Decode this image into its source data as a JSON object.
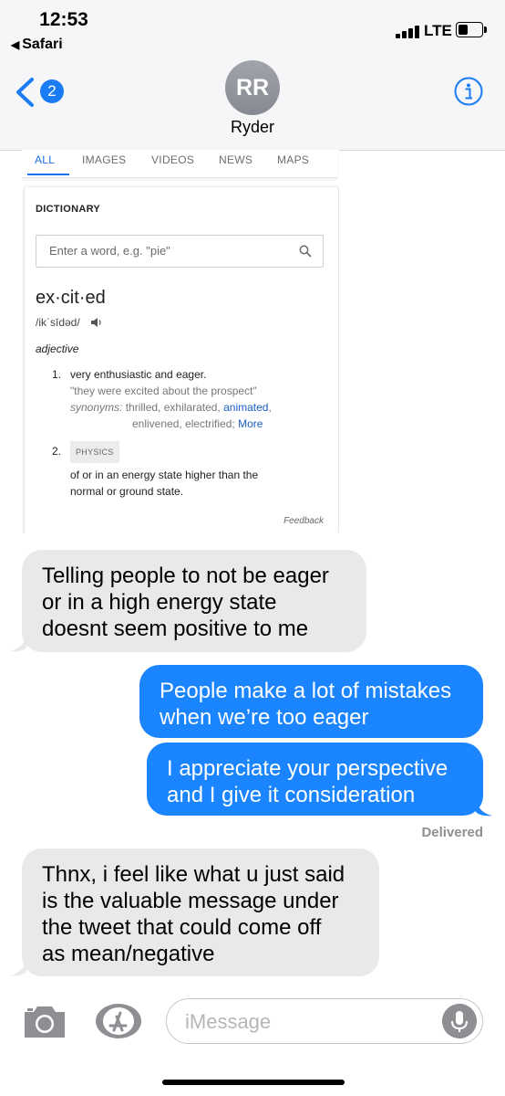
{
  "status_bar": {
    "time": "12:53",
    "back_app": "Safari",
    "network": "LTE"
  },
  "header": {
    "unread_count": "2",
    "avatar_initials": "RR",
    "contact_name": "Ryder"
  },
  "embedded_screenshot": {
    "tabs": [
      {
        "label": "ALL",
        "active": true
      },
      {
        "label": "IMAGES",
        "active": false
      },
      {
        "label": "VIDEOS",
        "active": false
      },
      {
        "label": "NEWS",
        "active": false
      },
      {
        "label": "MAPS",
        "active": false
      }
    ],
    "dictionary_label": "DICTIONARY",
    "search_placeholder": "Enter a word, e.g. \"pie\"",
    "headword": "ex·cit·ed",
    "pronunciation": "/ikˈsīdəd/",
    "part_of_speech": "adjective",
    "sense1": {
      "number": "1.",
      "definition": "very enthusiastic and eager.",
      "example": "\"they were excited about the prospect\"",
      "synonyms_label": "synonyms:",
      "synonyms_a": "thrilled, exhilarated, ",
      "synonyms_link": "animated",
      "synonyms_b": ",",
      "synonyms_c": "enlivened, electrified;",
      "more": "More"
    },
    "sense2": {
      "number": "2.",
      "tag": "PHYSICS",
      "definition_line1": "of or in an energy state higher than the",
      "definition_line2": "normal or ground state."
    },
    "feedback": "Feedback"
  },
  "messages": [
    {
      "direction": "incoming",
      "lines": [
        "Telling people to not be eager",
        "or in a high energy state",
        "doesnt seem positive to me"
      ]
    },
    {
      "direction": "outgoing",
      "lines": [
        "People make a lot of mistakes",
        "when we’re too eager"
      ]
    },
    {
      "direction": "outgoing",
      "lines": [
        "I appreciate your perspective",
        "and I give it consideration"
      ]
    },
    {
      "direction": "incoming",
      "lines": [
        "Thnx, i feel like what u just said",
        "is the valuable message under",
        "the tweet that could come off",
        "as mean/negative"
      ]
    }
  ],
  "delivery_status": "Delivered",
  "input_bar": {
    "placeholder": "iMessage"
  },
  "colors": {
    "imessage_blue": "#1b84ff",
    "incoming_gray": "#e9e9eb",
    "link_blue": "#1a73e8",
    "ios_blue": "#1a7cf5"
  },
  "icons": [
    "camera-icon",
    "app-store-icon",
    "microphone-icon",
    "info-icon",
    "back-chevron-icon",
    "search-icon",
    "speaker-icon"
  ]
}
